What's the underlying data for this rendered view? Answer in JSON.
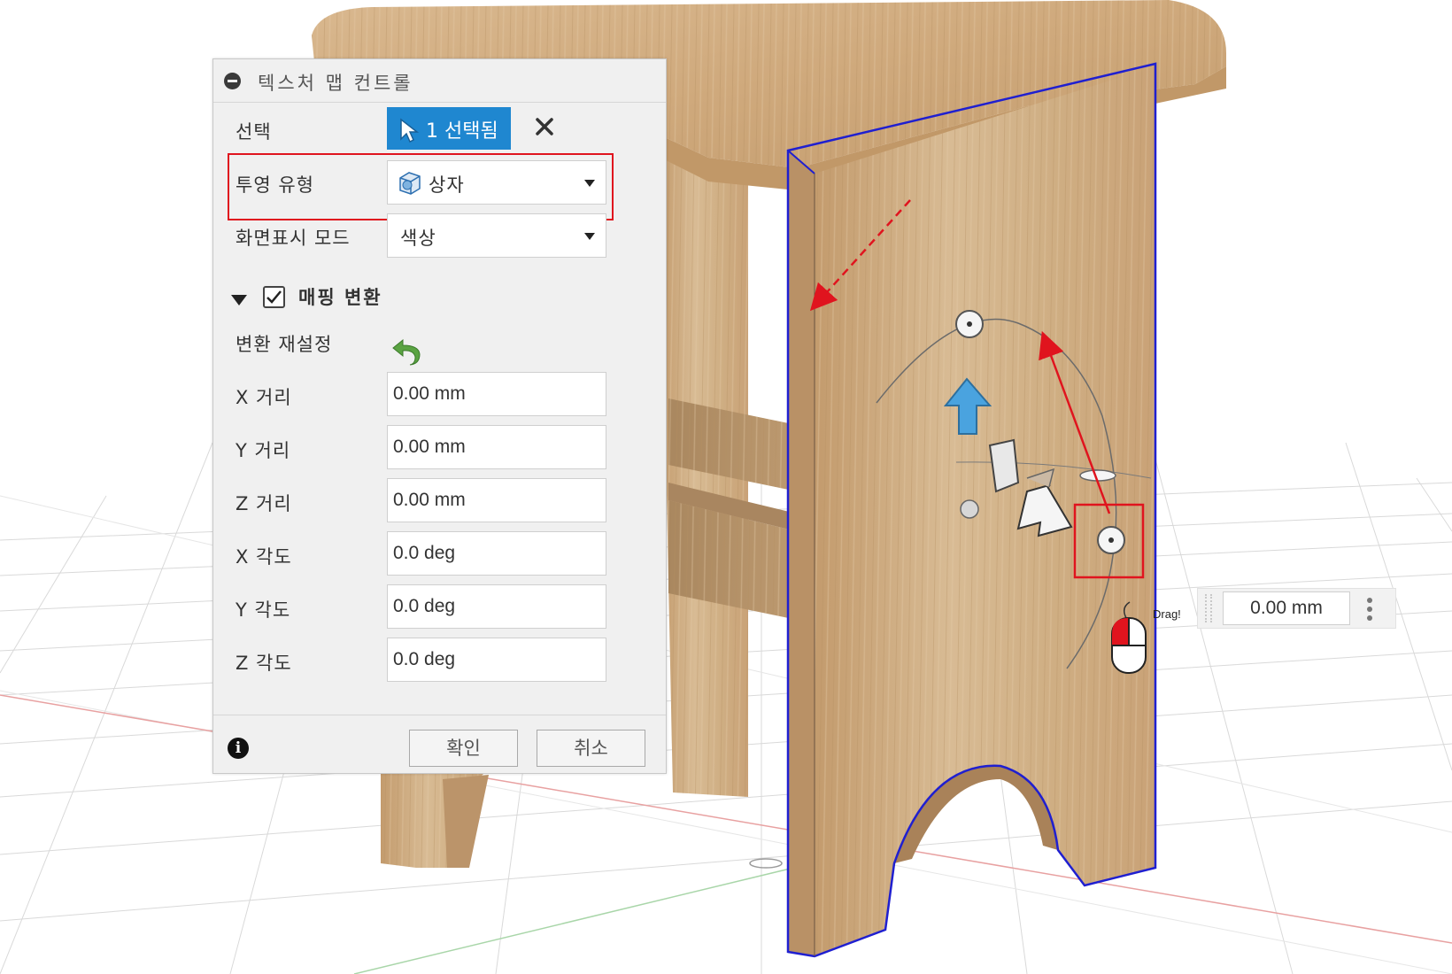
{
  "dialog": {
    "title": "텍스처 맵 컨트롤",
    "selection": {
      "label": "선택",
      "button_label": "1 선택됨"
    },
    "projection": {
      "label": "투영 유형",
      "value": "상자"
    },
    "display_mode": {
      "label": "화면표시 모드",
      "value": "색상"
    },
    "mapping_section": {
      "title": "매핑 변환",
      "checked": true
    },
    "reset_transform": {
      "label": "변환 재설정"
    },
    "fields": [
      {
        "label": "X 거리",
        "value": "0.00 mm"
      },
      {
        "label": "Y 거리",
        "value": "0.00 mm"
      },
      {
        "label": "Z 거리",
        "value": "0.00 mm"
      },
      {
        "label": "X 각도",
        "value": "0.0 deg"
      },
      {
        "label": "Y 각도",
        "value": "0.0 deg"
      },
      {
        "label": "Z 각도",
        "value": "0.0 deg"
      }
    ],
    "ok_label": "확인",
    "cancel_label": "취소"
  },
  "canvas": {
    "value_input": "0.00 mm",
    "drag_hint": "Drag!"
  },
  "colors": {
    "select_button": "#1f87d0",
    "annotation_red": "#e0141e",
    "selection_outline": "#1f1fd0",
    "wood": "#d2b48a",
    "manipulator_arrow": "#4aa3df"
  }
}
